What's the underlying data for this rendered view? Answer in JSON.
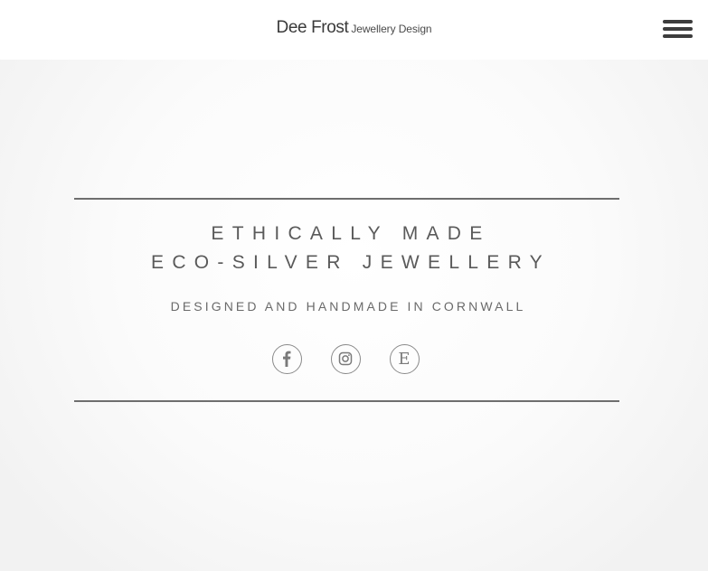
{
  "header": {
    "logo_main": "Dee Frost",
    "logo_sub": "Jewellery Design",
    "menu_icon": "hamburger-menu-icon"
  },
  "hero": {
    "headline_line1": "ETHICALLY MADE",
    "headline_line2": "ECO-SILVER JEWELLERY",
    "tagline": "DESIGNED AND HANDMADE IN CORNWALL"
  },
  "social": [
    {
      "icon": "facebook-icon"
    },
    {
      "icon": "instagram-icon"
    },
    {
      "icon": "etsy-icon",
      "glyph": "E"
    }
  ],
  "colors": {
    "rule": "#6e6e6e",
    "text": "#5a5a5a",
    "icon_border": "#8a8a8a"
  }
}
